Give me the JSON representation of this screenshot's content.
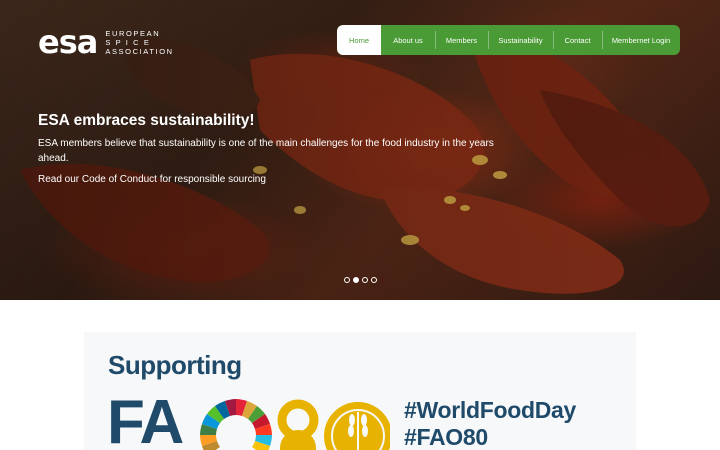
{
  "logo": {
    "mark": "esa",
    "line1": "EUROPEAN",
    "line2": "S P I C E",
    "line3": "ASSOCIATION"
  },
  "nav": {
    "items": [
      {
        "label": "Home",
        "active": true
      },
      {
        "label": "About us",
        "active": false
      },
      {
        "label": "Members",
        "active": false
      },
      {
        "label": "Sustainability",
        "active": false
      },
      {
        "label": "Contact",
        "active": false
      },
      {
        "label": "Membernet Login",
        "active": false
      }
    ]
  },
  "hero": {
    "title": "ESA embraces sustainability!",
    "text": "ESA members believe that sustainability is one of the main challenges for the food industry in the years ahead.",
    "link": "Read our Code of Conduct for responsible sourcing",
    "slides_total": 4,
    "active_slide": 2
  },
  "banner": {
    "supporting": "Supporting",
    "fao_letters": "FA",
    "hashtag1": "#WorldFoodDay",
    "hashtag2": "#FAO80"
  },
  "colors": {
    "nav_green": "#4a9a35",
    "brand_blue": "#1f4a6a",
    "gold": "#e8b200"
  }
}
